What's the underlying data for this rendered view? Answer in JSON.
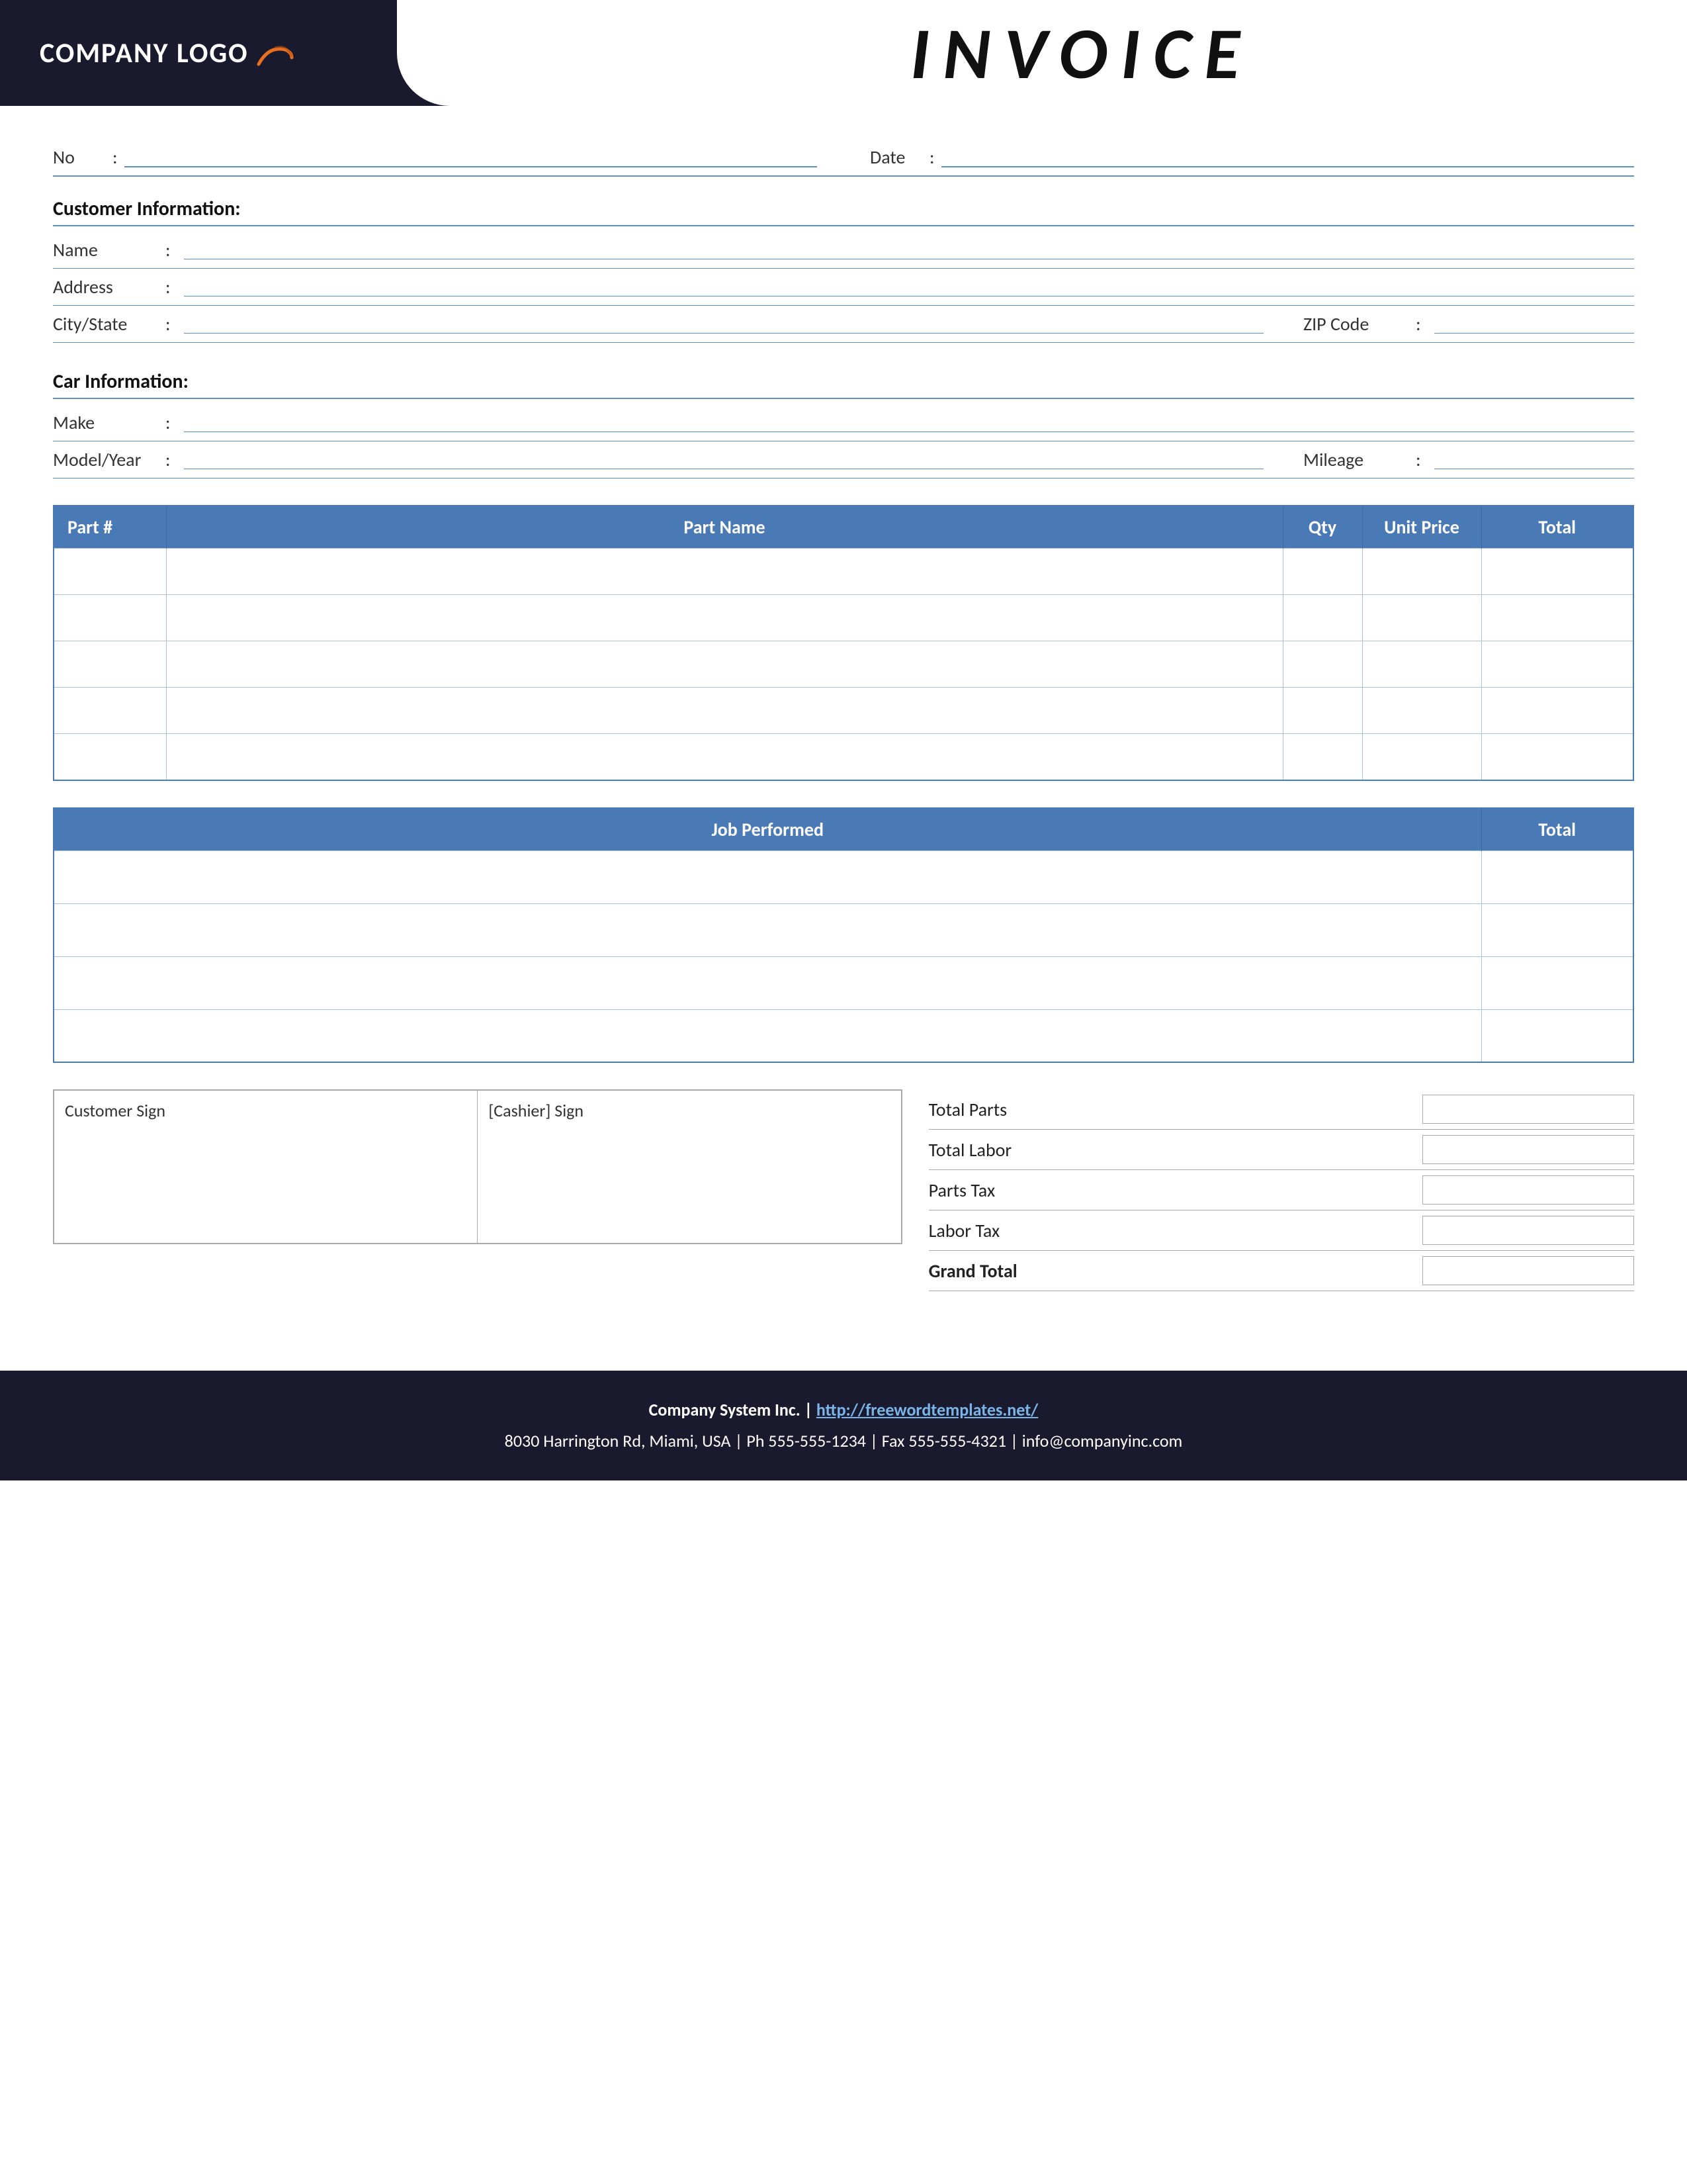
{
  "header": {
    "logo_text": "COMPANY LOGO",
    "invoice_title": "INVOICE"
  },
  "top": {
    "no_label": "No",
    "no_colon": ":",
    "date_label": "Date",
    "date_colon": ":"
  },
  "customer": {
    "section_title": "Customer Information:",
    "name_label": "Name",
    "name_colon": ":",
    "address_label": "Address",
    "address_colon": ":",
    "city_label": "City/State",
    "city_colon": ":",
    "zip_label": "ZIP Code",
    "zip_colon": ":"
  },
  "car": {
    "section_title": "Car Information:",
    "make_label": "Make",
    "make_colon": ":",
    "model_label": "Model/Year",
    "model_colon": ":",
    "mileage_label": "Mileage",
    "mileage_colon": ":"
  },
  "parts_table": {
    "col_part": "Part #",
    "col_name": "Part Name",
    "col_qty": "Qty",
    "col_unit": "Unit Price",
    "col_total": "Total",
    "rows": [
      {
        "part": "",
        "name": "",
        "qty": "",
        "unit": "",
        "total": ""
      },
      {
        "part": "",
        "name": "",
        "qty": "",
        "unit": "",
        "total": ""
      },
      {
        "part": "",
        "name": "",
        "qty": "",
        "unit": "",
        "total": ""
      },
      {
        "part": "",
        "name": "",
        "qty": "",
        "unit": "",
        "total": ""
      },
      {
        "part": "",
        "name": "",
        "qty": "",
        "unit": "",
        "total": ""
      }
    ]
  },
  "job_table": {
    "col_job": "Job Performed",
    "col_total": "Total",
    "rows": [
      {
        "job": "",
        "total": ""
      },
      {
        "job": "",
        "total": ""
      },
      {
        "job": "",
        "total": ""
      },
      {
        "job": "",
        "total": ""
      }
    ]
  },
  "signatures": {
    "customer_sign": "Customer Sign",
    "cashier_sign": "[Cashier] Sign"
  },
  "totals": {
    "total_parts_label": "Total Parts",
    "total_labor_label": "Total Labor",
    "parts_tax_label": "Parts Tax",
    "labor_tax_label": "Labor Tax",
    "grand_total_label": "Grand Total"
  },
  "footer": {
    "company_name": "Company System Inc.",
    "separator": "|",
    "website": "http://freewordtemplates.net/",
    "address_line": "8030 Harrington Rd, Miami, USA | Ph 555-555-1234 | Fax 555-555-4321 | info@companyinc.com"
  }
}
